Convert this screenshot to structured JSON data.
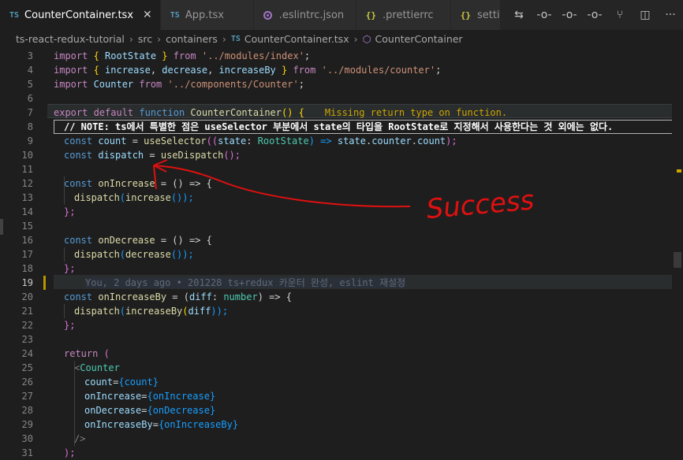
{
  "tabs": [
    {
      "type": "TS",
      "label": "CounterContainer.tsx",
      "active": true,
      "close": "✕"
    },
    {
      "type": "TS",
      "label": "App.tsx"
    },
    {
      "type": "eslint",
      "label": ".eslintrc.json"
    },
    {
      "type": "json",
      "icon": "{}",
      "label": ".prettierrc"
    },
    {
      "type": "json",
      "icon": "{}",
      "label": "settings.j"
    }
  ],
  "breadcrumb": {
    "project": "ts-react-redux-tutorial",
    "folder1": "src",
    "folder2": "containers",
    "file_icon": "TS",
    "file": "CounterContainer.tsx",
    "symbol": "CounterContainer"
  },
  "annotation": {
    "text": "Success",
    "color": "#e01010"
  },
  "line_numbers": [
    "3",
    "4",
    "5",
    "6",
    "7",
    "8",
    "9",
    "10",
    "11",
    "12",
    "13",
    "14",
    "15",
    "16",
    "17",
    "18",
    "19",
    "20",
    "21",
    "22",
    "23",
    "24",
    "25",
    "26",
    "27",
    "28",
    "29",
    "30",
    "31"
  ],
  "code": {
    "l3": [
      "import ",
      "{ ",
      "RootState",
      " } ",
      "from ",
      "'../modules/index'",
      ";"
    ],
    "l4": [
      "import ",
      "{ ",
      "increase",
      ", ",
      "decrease",
      ", ",
      "increaseBy",
      " } ",
      "from ",
      "'../modules/counter'",
      ";"
    ],
    "l5": [
      "import ",
      "Counter",
      " from ",
      "'../components/Counter'",
      ";"
    ],
    "l7": [
      "export ",
      "default ",
      "function ",
      "CounterContainer",
      "()",
      " {"
    ],
    "warning": "Missing return type on function.",
    "l8": "// NOTE: ts에서 특별한 점은 useSelector 부분에서 state의 타입을 RootState로 지정해서 사용한다는 것 외에는 없다.",
    "l9": [
      "const ",
      "count",
      " = ",
      "useSelector",
      "((",
      "state",
      ": ",
      "RootState",
      ") => ",
      "state",
      ".",
      "counter",
      ".",
      "count",
      ");"
    ],
    "l10": [
      "const ",
      "dispatch",
      " = ",
      "useDispatch",
      "();"
    ],
    "l12": [
      "const ",
      "onIncrease",
      " = () => {"
    ],
    "l13": [
      "dispatch",
      "(",
      "increase",
      "());"
    ],
    "l14": "};",
    "l16": [
      "const ",
      "onDecrease",
      " = () => {"
    ],
    "l17": [
      "dispatch",
      "(",
      "decrease",
      "());"
    ],
    "l18": "};",
    "blame": "You, 2 days ago • 201228 ts+redux 카운터 완성, eslint 재설정",
    "l20": [
      "const ",
      "onIncreaseBy",
      " = (",
      "diff",
      ": ",
      "number",
      ") => {"
    ],
    "l21": [
      "dispatch",
      "(",
      "increaseBy",
      "(",
      "diff",
      "));"
    ],
    "l22": "};",
    "l24": [
      "return ",
      "("
    ],
    "l25": [
      "<",
      "Counter"
    ],
    "l26": [
      "count",
      "=",
      "{count}"
    ],
    "l27": [
      "onIncrease",
      "=",
      "{onIncrease}"
    ],
    "l28": [
      "onDecrease",
      "=",
      "{onDecrease}"
    ],
    "l29": [
      "onIncreaseBy",
      "=",
      "{onIncreaseBy}"
    ],
    "l30": "/>",
    "l31": ");"
  }
}
